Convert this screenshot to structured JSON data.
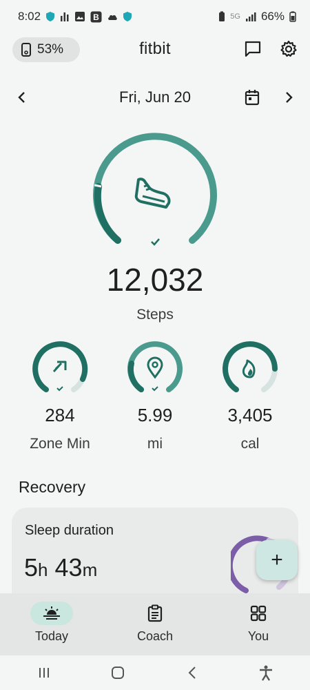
{
  "status_bar": {
    "time": "8:02",
    "network": "5G",
    "battery": "66%"
  },
  "header": {
    "device_battery": "53%",
    "app_title": "fitbit"
  },
  "date_nav": {
    "date": "Fri, Jun 20"
  },
  "steps": {
    "value": "12,032",
    "label": "Steps",
    "goal_fraction": 1.0
  },
  "metrics": [
    {
      "value": "284",
      "label": "Zone Min",
      "icon": "zone-arrow-icon",
      "progress": 0.9
    },
    {
      "value": "5.99",
      "label": "mi",
      "icon": "location-pin-icon",
      "progress": 1.0
    },
    {
      "value": "3,405",
      "label": "cal",
      "icon": "flame-icon",
      "progress": 0.83
    }
  ],
  "recovery": {
    "section_title": "Recovery",
    "card_title": "Sleep duration",
    "hours": "5",
    "hours_unit": "h",
    "minutes": "43",
    "minutes_unit": "m"
  },
  "fab": {
    "label": "+"
  },
  "bottom_nav": [
    {
      "label": "Today",
      "icon": "sunrise-icon",
      "active": true
    },
    {
      "label": "Coach",
      "icon": "clipboard-icon",
      "active": false
    },
    {
      "label": "You",
      "icon": "grid-icon",
      "active": false
    }
  ],
  "colors": {
    "accent": "#1f6f63",
    "accent_light": "#4a9a8d",
    "ring_track": "#d7e3e0",
    "sleep_accent": "#7b5ea7"
  }
}
